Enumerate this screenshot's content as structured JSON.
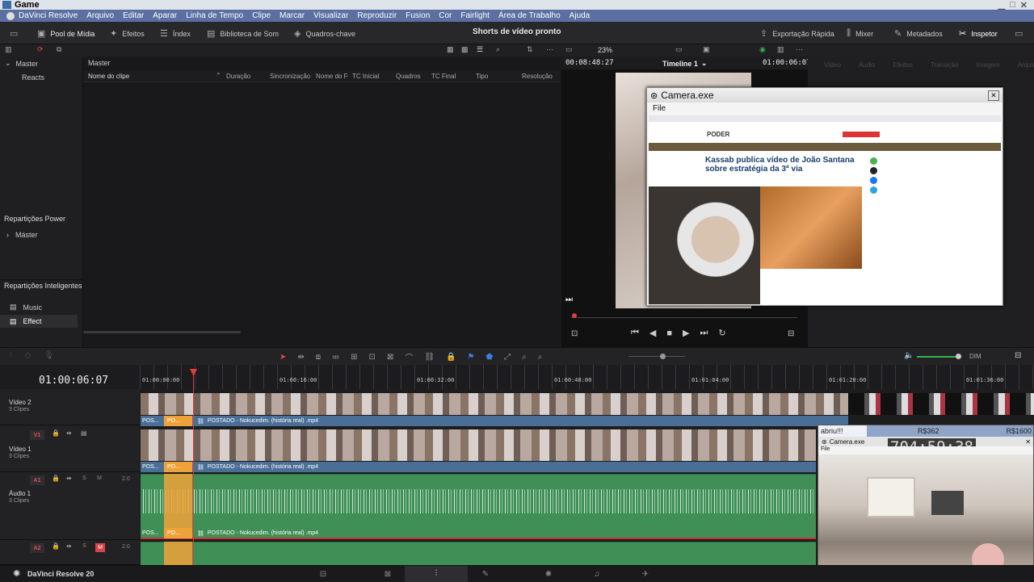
{
  "window_title": "Game",
  "menu": [
    "DaVinci Resolve",
    "Arquivo",
    "Editar",
    "Aparar",
    "Linha de Tempo",
    "Clipe",
    "Marcar",
    "Visualizar",
    "Reproduzir",
    "Fusion",
    "Cor",
    "Fairlight",
    "Área de Trabalho",
    "Ajuda"
  ],
  "toolbar": {
    "media_pool": "Pool de Mídia",
    "effects": "Efeitos",
    "index": "Índex",
    "sound_library": "Biblioteca de Som",
    "keyframes": "Quadros-chave",
    "project_title": "Shorts de vídeo pronto",
    "quick_export": "Exportação Rápida",
    "mixer": "Mixer",
    "metadata": "Metadados",
    "inspector": "Inspetor"
  },
  "left_panel": {
    "master": "Master",
    "reacts": "Reacts",
    "power_bins": "Repartições Power",
    "power_master": "Máster",
    "smart_bins": "Repartições Inteligentes",
    "smart_items": [
      "Music",
      "Effect"
    ]
  },
  "media_pool": {
    "breadcrumb": "Master",
    "columns": [
      "Nome do clipe",
      "Duração",
      "Sincronização",
      "Nome do F",
      "TC Inicial",
      "Quadros",
      "TC Final",
      "Tipo",
      "Resolução"
    ]
  },
  "viewer": {
    "zoom": "23%",
    "source_tc": "00:08:48:27",
    "timeline_name": "Timeline 1",
    "record_tc": "01:00:06:07"
  },
  "inspector_tabs": [
    "Vídeo",
    "Áudio",
    "Efeitos",
    "Transição",
    "Imagem",
    "Arquivo"
  ],
  "camera_window": {
    "title": "Camera.exe",
    "menu": "File",
    "headline": "Kassab publica vídeo de João Santana sobre estratégia da 3ª via",
    "site": "PODER"
  },
  "timeline": {
    "timecode": "01:00:06:07",
    "ruler": [
      "01:00:00:00",
      "01:00:16:00",
      "01:00:32:00",
      "01:00:48:00",
      "01:01:04:00",
      "01:01:20:00",
      "01:01:36:00"
    ],
    "volume_label": "DIM",
    "tracks": [
      {
        "id": "V2",
        "name": "Vídeo 2",
        "clips": "3 Clipes",
        "clip_short": "POS...",
        "clip_mid": "PO...",
        "clip_name": "POSTADO - Nokucedim. (história real) .mp4"
      },
      {
        "id": "V1",
        "name": "Vídeo 1",
        "clips": "3 Clipes",
        "clip_short": "POS...",
        "clip_mid": "PO...",
        "clip_name": "POSTADO - Nokucedim. (história real) .mp4"
      },
      {
        "id": "A1",
        "name": "Áudio 1",
        "clips": "3 Clipes",
        "level": "2.0",
        "clip_short": "POS...",
        "clip_mid": "PO...",
        "clip_name": "POSTADO - Nokucedim. (história real) .mp4"
      },
      {
        "id": "A2",
        "level": "2.0"
      }
    ]
  },
  "overlay": {
    "label_left": "abriu!!!",
    "label_mid": "R$362",
    "label_right": "R$1600",
    "big_time": "704:59:38",
    "cam_title": "Camera.exe",
    "cam_menu": "File"
  },
  "status": {
    "app": "DaVinci Resolve 20"
  },
  "colors": {
    "accent": "#e64a4a",
    "playhead": "#e23b3b",
    "video_clip": "#4a6f97",
    "audio_clip": "#3f8f57",
    "selected": "#f0a23a"
  }
}
